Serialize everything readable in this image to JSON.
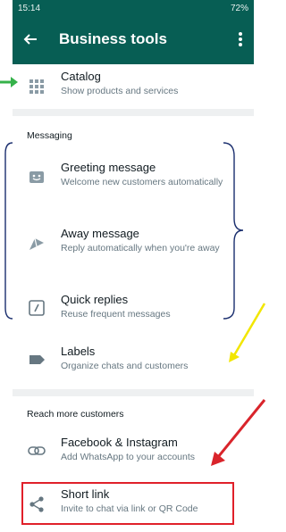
{
  "status": {
    "time": "15:14",
    "battery": "72%"
  },
  "appbar": {
    "title": "Business tools"
  },
  "items": {
    "catalog": {
      "title": "Catalog",
      "subtitle": "Show products and services"
    },
    "greeting": {
      "title": "Greeting message",
      "subtitle": "Welcome new customers automatically"
    },
    "away": {
      "title": "Away message",
      "subtitle": "Reply automatically when you're away"
    },
    "quick": {
      "title": "Quick replies",
      "subtitle": "Reuse frequent messages"
    },
    "labels": {
      "title": "Labels",
      "subtitle": "Organize chats and customers"
    },
    "facebook": {
      "title": "Facebook & Instagram",
      "subtitle": "Add WhatsApp to your accounts"
    },
    "shortlink": {
      "title": "Short link",
      "subtitle": "Invite to chat via link or QR Code"
    }
  },
  "sections": {
    "messaging": "Messaging",
    "reach": "Reach more customers"
  },
  "colors": {
    "header": "#075e54",
    "highlight": "#e0202a",
    "arrow_yellow": "#f2e600",
    "arrow_green": "#35b24a",
    "bracket": "#1a2e6e"
  },
  "icons": [
    "back-arrow-icon",
    "more-vert-icon",
    "grid-icon",
    "greeting-icon",
    "away-icon",
    "quick-reply-icon",
    "label-icon",
    "link-icon",
    "share-icon"
  ]
}
